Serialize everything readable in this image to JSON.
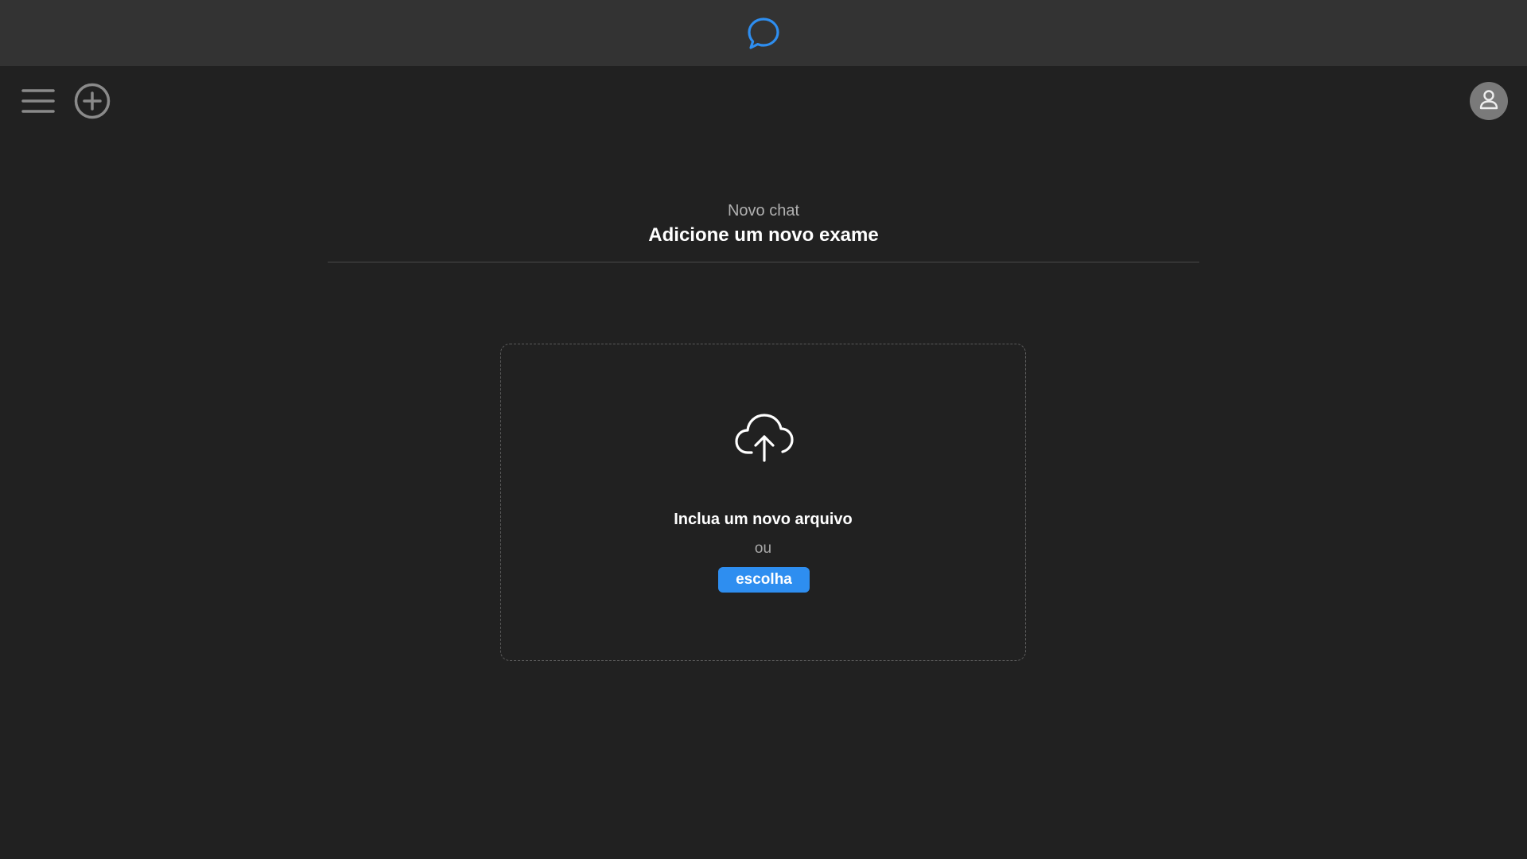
{
  "colors": {
    "background": "#212121",
    "topbar": "#333333",
    "accent": "#2e8ef0",
    "icon_gray": "#8a8a8a",
    "avatar_bg": "#7a7a7a"
  },
  "topbar": {
    "logo_icon": "chat-bubble-icon"
  },
  "toolbar": {
    "menu_icon": "hamburger-menu-icon",
    "new_chat_icon": "plus-circle-icon",
    "avatar_icon": "user-icon"
  },
  "header": {
    "subtitle": "Novo chat",
    "title": "Adicione um novo exame"
  },
  "dropzone": {
    "icon": "cloud-upload-icon",
    "label": "Inclua um novo arquivo",
    "or_label": "ou",
    "choose_label": "escolha"
  }
}
